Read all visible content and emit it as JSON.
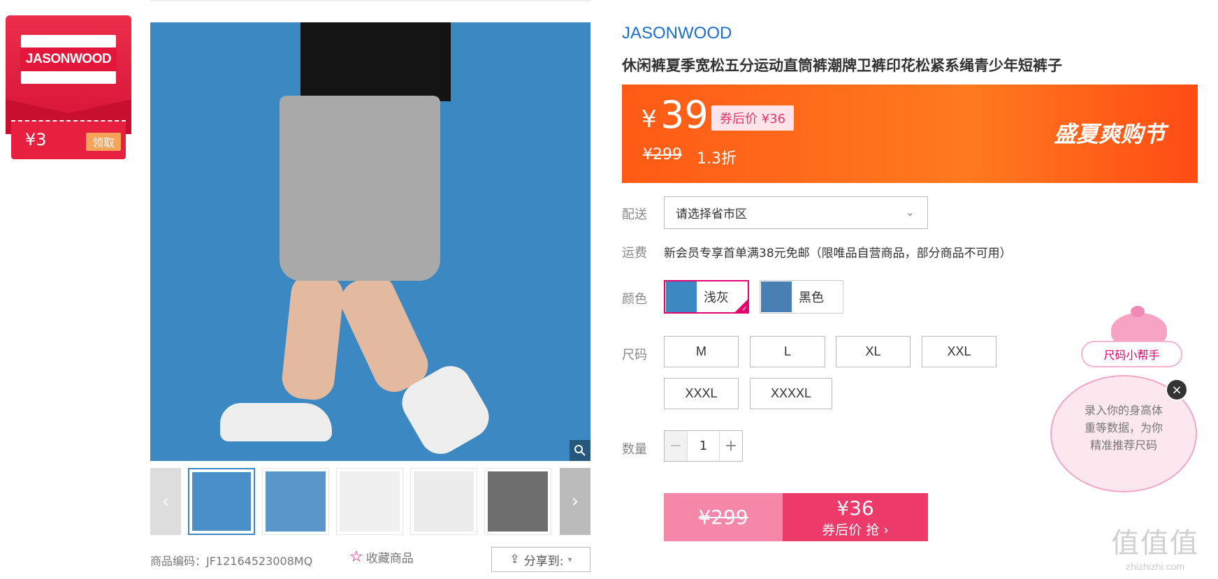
{
  "coupon": {
    "logo_text": "JASONWOOD",
    "amount": "¥3",
    "claim_label": "领取"
  },
  "gallery": {
    "zoom_icon": "search-icon",
    "prev_icon": "chevron-left-icon",
    "next_icon": "chevron-right-icon",
    "thumbnails": [
      "product-photo-1",
      "product-photo-2",
      "product-detail-1",
      "product-detail-2",
      "fabric-detail"
    ]
  },
  "meta": {
    "sku_label": "商品编码：JF12164523008MQ",
    "favorite_label": "收藏商品",
    "share_label": "分享到:"
  },
  "product": {
    "brand": "JASONWOOD",
    "title": "休闲裤夏季宽松五分运动直筒裤潮牌卫裤印花松紧系绳青少年短裤子"
  },
  "price": {
    "currency": "¥",
    "current": "39",
    "after_coupon_label": "券后价 ¥36",
    "original": "¥299",
    "discount": "1.3折",
    "festival": "盛夏爽购节",
    "accent_color": "#ff5a16"
  },
  "shipping": {
    "delivery_label": "配送",
    "region_placeholder": "请选择省市区",
    "fee_label": "运费",
    "fee_text": "新会员专享首单满38元免邮（限唯品自营商品，部分商品不可用）"
  },
  "color": {
    "label": "颜色",
    "options": [
      {
        "name": "浅灰",
        "selected": true
      },
      {
        "name": "黑色",
        "selected": false
      }
    ]
  },
  "size": {
    "label": "尺码",
    "options": [
      "M",
      "L",
      "XL",
      "XXL",
      "XXXL",
      "XXXXL"
    ]
  },
  "quantity": {
    "label": "数量",
    "value": "1",
    "minus": "−",
    "plus": "+"
  },
  "buy": {
    "original_price": "¥299",
    "price": "¥36",
    "label": "券后价 抢 ›",
    "accent_color": "#ec3a6b"
  },
  "size_helper": {
    "tag": "尺码小帮手",
    "line1": "录入你的身高体",
    "line2": "重等数据，为你",
    "line3": "精准推荐尺码",
    "close": "×"
  },
  "watermark": {
    "glyph": "值值值",
    "url": "zhizhizhi.com"
  }
}
